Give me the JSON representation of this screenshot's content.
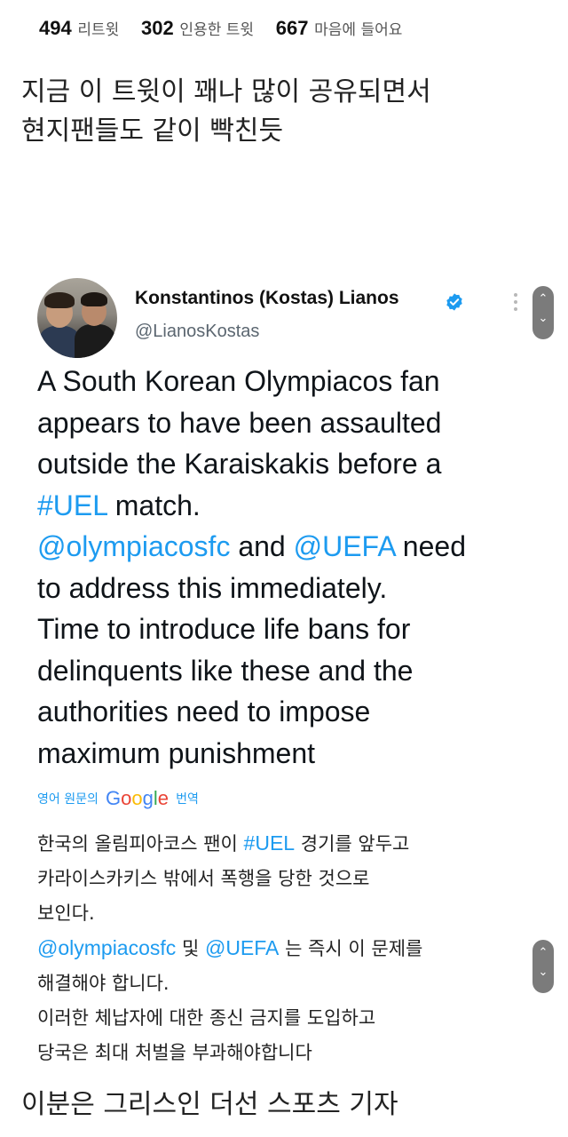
{
  "stats": [
    {
      "count": "494",
      "label": "리트윗"
    },
    {
      "count": "302",
      "label": "인용한 트윗"
    },
    {
      "count": "667",
      "label": "마음에 들어요"
    }
  ],
  "caption_top": [
    "지금 이 트윗이 꽤나 많이 공유되면서",
    "현지팬들도 같이 빡친듯"
  ],
  "tweet": {
    "author_name": "Konstantinos (Kostas) Lianos",
    "author_handle": "@LianosKostas",
    "lines": [
      [
        {
          "t": "A South Korean Olympiacos fan",
          "link": false
        }
      ],
      [
        {
          "t": "appears to have been assaulted",
          "link": false
        }
      ],
      [
        {
          "t": "outside the Karaiskakis before a",
          "link": false
        }
      ],
      [
        {
          "t": "#UEL",
          "link": true
        },
        {
          "t": " match.",
          "link": false
        }
      ],
      [
        {
          "t": "@olympiacosfc",
          "link": true
        },
        {
          "t": " and ",
          "link": false
        },
        {
          "t": "@UEFA",
          "link": true
        },
        {
          "t": " need",
          "link": false
        }
      ],
      [
        {
          "t": "to address this immediately.",
          "link": false
        }
      ],
      [
        {
          "t": "Time to introduce life bans for",
          "link": false
        }
      ],
      [
        {
          "t": "delinquents like these and the",
          "link": false
        }
      ],
      [
        {
          "t": "authorities need to impose",
          "link": false
        }
      ],
      [
        {
          "t": "maximum punishment",
          "link": false
        }
      ]
    ]
  },
  "translate": {
    "label": "영어 원문의",
    "service": "Google",
    "action": "번역"
  },
  "translation_lines": [
    [
      {
        "t": "한국의 올림피아코스 팬이 ",
        "link": false
      },
      {
        "t": "#UEL",
        "link": true
      },
      {
        "t": " 경기를 앞두고",
        "link": false
      }
    ],
    [
      {
        "t": "카라이스카키스 밖에서 폭행을 당한 것으로",
        "link": false
      }
    ],
    [
      {
        "t": "보인다.",
        "link": false
      }
    ],
    [
      {
        "t": "@olympiacosfc",
        "link": true
      },
      {
        "t": " 및 ",
        "link": false
      },
      {
        "t": "@UEFA",
        "link": true
      },
      {
        "t": " 는 즉시 이 문제를",
        "link": false
      }
    ],
    [
      {
        "t": "해결해야 합니다.",
        "link": false
      }
    ],
    [
      {
        "t": "이러한 체납자에 대한 종신 금지를 도입하고",
        "link": false
      }
    ],
    [
      {
        "t": "당국은 최대 처벌을 부과해야합니다",
        "link": false
      }
    ]
  ],
  "caption_bottom": "이분은 그리스인 더선 스포츠 기자",
  "colors": {
    "link": "#1d9bf0",
    "verified": "#1d9bf0",
    "scroll_pill": "#7b7b7b"
  },
  "icons": [
    "verified-badge-icon",
    "kebab-menu-icon",
    "scroll-up-icon",
    "scroll-down-icon"
  ]
}
